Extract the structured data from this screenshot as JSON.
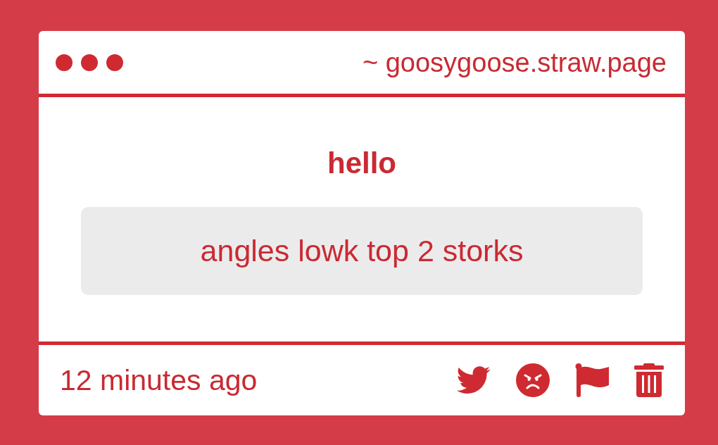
{
  "window": {
    "address": "~ goosygoose.straw.page"
  },
  "post": {
    "title": "hello",
    "message": "angles lowk top 2 storks"
  },
  "footer": {
    "time": "12 minutes ago"
  }
}
